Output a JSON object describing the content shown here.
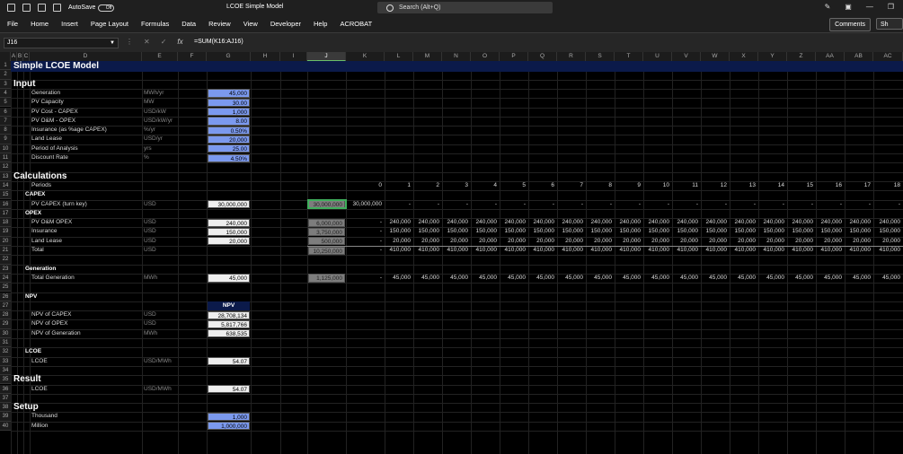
{
  "titlebar": {
    "autosave_label": "AutoSave",
    "autosave_state": "Off",
    "doc_title": "LCOE Simple Model",
    "search_placeholder": "Search (Alt+Q)"
  },
  "menu": {
    "items": [
      "File",
      "Home",
      "Insert",
      "Page Layout",
      "Formulas",
      "Data",
      "Review",
      "View",
      "Developer",
      "Help",
      "ACROBAT"
    ],
    "comments": "Comments",
    "share": "Sh"
  },
  "formula_bar": {
    "name_box": "J16",
    "formula": "=SUM(K16:AJ16)"
  },
  "columns": [
    "A",
    "B",
    "C",
    "D",
    "E",
    "F",
    "G",
    "H",
    "I",
    "J",
    "K",
    "L",
    "M",
    "N",
    "O",
    "P",
    "Q",
    "R",
    "S",
    "T",
    "U",
    "V",
    "W",
    "X",
    "Y",
    "Z",
    "AA",
    "AB",
    "AC"
  ],
  "rows": [
    "1",
    "2",
    "3",
    "4",
    "5",
    "6",
    "7",
    "8",
    "9",
    "10",
    "11",
    "12",
    "13",
    "14",
    "15",
    "16",
    "17",
    "18",
    "19",
    "20",
    "21",
    "22",
    "23",
    "24",
    "25",
    "26",
    "27",
    "28",
    "29",
    "30",
    "31",
    "32",
    "33",
    "34",
    "35",
    "36",
    "37",
    "38",
    "39",
    "40"
  ],
  "sheet": {
    "title": "Simple LCOE Model",
    "input_header": "Input",
    "inputs": [
      {
        "label": "Generation",
        "unit": "MWh/yr",
        "value": "45,000"
      },
      {
        "label": "PV Capacity",
        "unit": "MW",
        "value": "30.00"
      },
      {
        "label": "PV Cost - CAPEX",
        "unit": "USD/kW",
        "value": "1,000"
      },
      {
        "label": "PV O&M - OPEX",
        "unit": "USD/kW/yr",
        "value": "8.00"
      },
      {
        "label": "Insurance (as %age CAPEX)",
        "unit": "%/yr",
        "value": "0.50%"
      },
      {
        "label": "Land Lease",
        "unit": "USD/yr",
        "value": "20,000"
      },
      {
        "label": "Period of Analysis",
        "unit": "yrs",
        "value": "25.00"
      },
      {
        "label": "Discount Rate",
        "unit": "%",
        "value": "4.50%"
      }
    ],
    "calc_header": "Calculations",
    "periods_label": "Periods",
    "periods": [
      "0",
      "1",
      "2",
      "3",
      "4",
      "5",
      "6",
      "7",
      "8",
      "9",
      "10",
      "11",
      "12",
      "13",
      "14",
      "15",
      "16",
      "17",
      "18"
    ],
    "capex_label": "CAPEX",
    "capex_row": {
      "label": "PV CAPEX (turn key)",
      "unit": "USD",
      "g": "30,000,000",
      "j": "30,000,000",
      "k": "30,000,000",
      "rest": "-"
    },
    "opex_label": "OPEX",
    "opex_rows": [
      {
        "label": "PV O&M OPEX",
        "unit": "USD",
        "g": "240,000",
        "j": "6,000,000",
        "k": "-",
        "rest": "240,000"
      },
      {
        "label": "Insurance",
        "unit": "USD",
        "g": "150,000",
        "j": "3,750,000",
        "k": "-",
        "rest": "150,000"
      },
      {
        "label": "Land Lease",
        "unit": "USD",
        "g": "20,000",
        "j": "500,000",
        "k": "-",
        "rest": "20,000"
      },
      {
        "label": "Total",
        "unit": "USD",
        "g": "",
        "j": "10,250,000",
        "k": "-",
        "rest": "410,000"
      }
    ],
    "gen_label": "Generation",
    "gen_row": {
      "label": "Total Generation",
      "unit": "MWh",
      "g": "45,000",
      "j": "1,125,000",
      "k": "-",
      "rest": "45,000"
    },
    "npv_label": "NPV",
    "npv_header": "NPV",
    "npv_rows": [
      {
        "label": "NPV of CAPEX",
        "unit": "USD",
        "value": "28,708,134"
      },
      {
        "label": "NPV of OPEX",
        "unit": "USD",
        "value": "5,817,766"
      },
      {
        "label": "NPV of Generation",
        "unit": "MWh",
        "value": "638,535"
      }
    ],
    "lcoe_label": "LCOE",
    "lcoe_row": {
      "label": "LCOE",
      "unit": "USD/MWh",
      "value": "54.07"
    },
    "result_header": "Result",
    "result_row": {
      "label": "LCOE",
      "unit": "USD/MWh",
      "value": "54.07"
    },
    "setup_header": "Setup",
    "setup_rows": [
      {
        "label": "Thousand",
        "value": "1,000"
      },
      {
        "label": "Million",
        "value": "1,000,000"
      }
    ]
  },
  "colors": {
    "banner": "#0b1a4a",
    "input_fill": "#7b99ee",
    "selection": "#3fae5b"
  }
}
